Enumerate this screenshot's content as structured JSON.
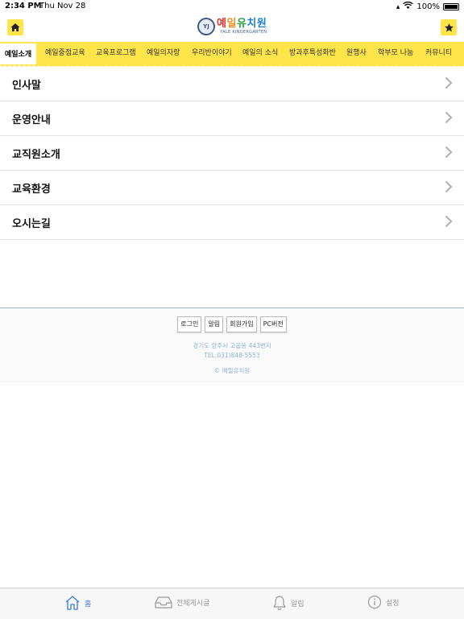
{
  "status_bar": {
    "time": "2:34 PM",
    "date": "Thu Nov 28",
    "battery": "100%"
  },
  "header": {
    "logo_main": [
      "예",
      "일",
      "유",
      "치원"
    ],
    "logo_sub": "YALE KINDERGARTEN",
    "logo_emblem": "YJ"
  },
  "nav": {
    "items": [
      "예일소개",
      "예일중점교육",
      "교육프로그램",
      "예일의자랑",
      "우리반이야기",
      "예일의 소식",
      "방과후특성화반",
      "원행사",
      "학부모 나눔",
      "커뮤니티"
    ]
  },
  "menu": {
    "items": [
      "인사말",
      "운영안내",
      "교직원소개",
      "교육환경",
      "오시는길"
    ]
  },
  "footer": {
    "buttons": [
      "로그인",
      "알림",
      "회원가입",
      "PC버전"
    ],
    "address": "경기도 양주시 고읍동 443번지",
    "tel": "TEL:031)848-5553",
    "copyright": "© 예일유치원"
  },
  "tabbar": {
    "tabs": [
      {
        "label": "홈",
        "icon": "home-icon"
      },
      {
        "label": "전체게시글",
        "icon": "inbox-icon"
      },
      {
        "label": "알림",
        "icon": "bell-icon"
      },
      {
        "label": "설정",
        "icon": "info-icon"
      }
    ]
  },
  "colors": {
    "accent": "#ffe44a",
    "tab_active": "#3a7bd5",
    "footer_text": "#8fb0d8"
  }
}
